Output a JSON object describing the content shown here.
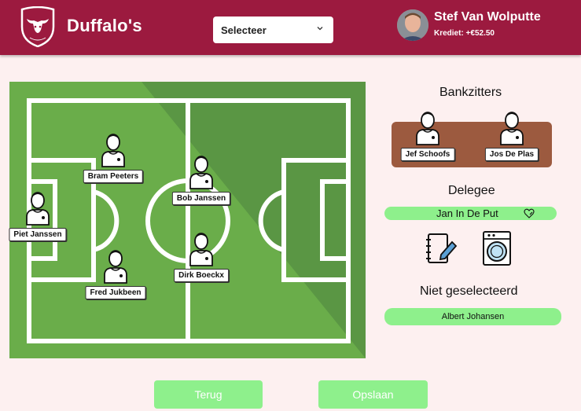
{
  "header": {
    "brand": "Duffalo's",
    "logo_icon": "bull-crest-logo",
    "select_label": "Selecteer",
    "user_name": "Stef Van Wolputte",
    "credit": "Krediet: +€52.50"
  },
  "colors": {
    "header_bg": "#9c1a3f",
    "pitch_light": "#6aad4a",
    "pitch_dark": "#5a9644",
    "bench_bg": "#9c5a3f",
    "accent_green": "#8ef08c",
    "page_bg": "#fdf0f0"
  },
  "pitch": {
    "players": [
      {
        "name": "Bram Peeters"
      },
      {
        "name": "Bob Janssen"
      },
      {
        "name": "Piet Janssen"
      },
      {
        "name": "Fred Jukbeen"
      },
      {
        "name": "Dirk Boeckx"
      }
    ]
  },
  "bench": {
    "title": "Bankzitters",
    "players": [
      {
        "name": "Jef Schoofs"
      },
      {
        "name": "Jos De Plas"
      }
    ]
  },
  "delegee": {
    "title": "Delegee",
    "name": "Jan In De Put",
    "icon": "heart-edit-icon"
  },
  "tools": [
    "notebook-edit-icon",
    "washing-machine-icon"
  ],
  "not_selected": {
    "title": "Niet geselecteerd",
    "players": [
      {
        "name": "Albert Johansen"
      }
    ]
  },
  "footer": {
    "back_label": "Terug",
    "save_label": "Opslaan"
  }
}
